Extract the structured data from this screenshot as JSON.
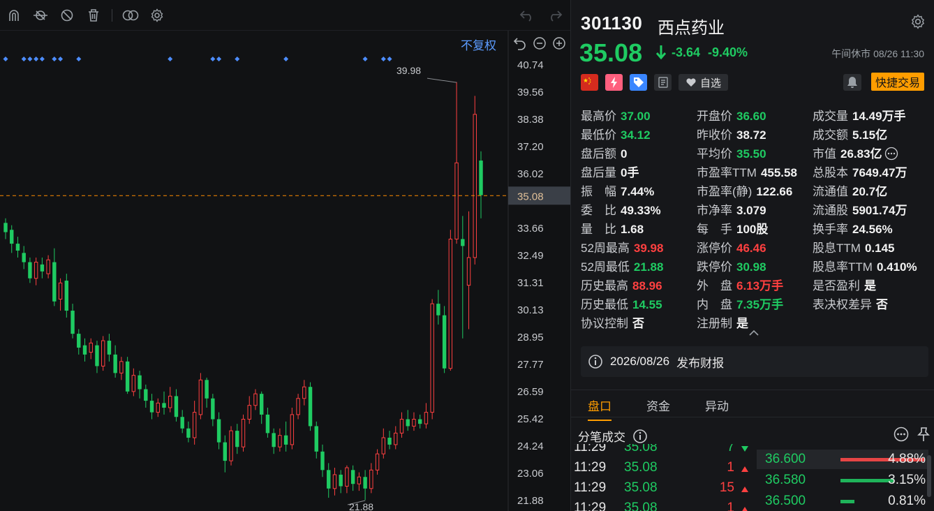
{
  "toolbar": {
    "icons": [
      "magnet-icon",
      "indicator-icon",
      "hide-icon",
      "trash-icon",
      "overlay-icon",
      "gear-icon"
    ],
    "undo_label": "undo-icon",
    "redo_label": "redo-icon"
  },
  "chart": {
    "adjust_label": "不复权",
    "price_axis": [
      "40.74",
      "39.56",
      "38.38",
      "37.20",
      "36.02",
      "35.08",
      "33.66",
      "32.49",
      "31.31",
      "30.13",
      "28.95",
      "27.77",
      "26.59",
      "25.42",
      "24.24",
      "23.06",
      "21.88"
    ],
    "current_price": "35.08",
    "high_label": "39.98",
    "low_label": "21.88",
    "colors": {
      "up": "#ff4040",
      "down": "#1fcb62",
      "marker": "#4d8dff",
      "current_line": "#ff8a00"
    }
  },
  "chart_data": {
    "type": "candlestick",
    "y_range": [
      21.88,
      40.74
    ],
    "max_marker": 39.98,
    "min_marker": 21.88,
    "current_price": 35.08,
    "candles": [
      {
        "o": 33.9,
        "c": 33.5,
        "h": 34.1,
        "l": 33.2
      },
      {
        "o": 33.6,
        "c": 33.0,
        "h": 33.8,
        "l": 32.6
      },
      {
        "o": 33.0,
        "c": 32.7,
        "h": 33.3,
        "l": 32.4
      },
      {
        "o": 32.6,
        "c": 32.2,
        "h": 32.9,
        "l": 31.9
      },
      {
        "o": 32.2,
        "c": 31.5,
        "h": 32.4,
        "l": 31.3
      },
      {
        "o": 31.5,
        "c": 32.2,
        "h": 32.4,
        "l": 31.2
      },
      {
        "o": 32.1,
        "c": 31.8,
        "h": 32.4,
        "l": 31.5
      },
      {
        "o": 31.7,
        "c": 32.3,
        "h": 32.5,
        "l": 31.5
      },
      {
        "o": 32.2,
        "c": 30.5,
        "h": 32.8,
        "l": 30.3
      },
      {
        "o": 30.6,
        "c": 31.3,
        "h": 31.5,
        "l": 30.1
      },
      {
        "o": 31.4,
        "c": 30.1,
        "h": 31.7,
        "l": 29.8
      },
      {
        "o": 30.1,
        "c": 29.1,
        "h": 30.4,
        "l": 28.9
      },
      {
        "o": 29.1,
        "c": 28.5,
        "h": 29.3,
        "l": 28.2
      },
      {
        "o": 28.6,
        "c": 28.2,
        "h": 28.9,
        "l": 27.9
      },
      {
        "o": 28.3,
        "c": 28.7,
        "h": 28.9,
        "l": 28.0
      },
      {
        "o": 28.6,
        "c": 27.7,
        "h": 28.8,
        "l": 27.4
      },
      {
        "o": 27.7,
        "c": 28.8,
        "h": 29.0,
        "l": 27.5
      },
      {
        "o": 28.8,
        "c": 28.2,
        "h": 29.1,
        "l": 27.9
      },
      {
        "o": 28.2,
        "c": 27.4,
        "h": 28.6,
        "l": 27.2
      },
      {
        "o": 27.4,
        "c": 27.9,
        "h": 28.1,
        "l": 27.1
      },
      {
        "o": 27.9,
        "c": 26.6,
        "h": 28.1,
        "l": 26.5
      },
      {
        "o": 26.6,
        "c": 27.3,
        "h": 27.6,
        "l": 26.4
      },
      {
        "o": 27.3,
        "c": 26.7,
        "h": 27.5,
        "l": 26.3
      },
      {
        "o": 26.7,
        "c": 26.2,
        "h": 26.9,
        "l": 25.9
      },
      {
        "o": 26.2,
        "c": 25.7,
        "h": 26.5,
        "l": 25.4
      },
      {
        "o": 25.7,
        "c": 26.1,
        "h": 26.3,
        "l": 25.5
      },
      {
        "o": 26.1,
        "c": 25.9,
        "h": 26.6,
        "l": 25.6
      },
      {
        "o": 25.9,
        "c": 26.4,
        "h": 26.8,
        "l": 25.7
      },
      {
        "o": 26.4,
        "c": 25.5,
        "h": 26.7,
        "l": 25.3
      },
      {
        "o": 25.5,
        "c": 25.0,
        "h": 25.8,
        "l": 24.8
      },
      {
        "o": 25.0,
        "c": 24.6,
        "h": 25.3,
        "l": 24.4
      },
      {
        "o": 24.6,
        "c": 25.7,
        "h": 26.2,
        "l": 24.3
      },
      {
        "o": 25.6,
        "c": 27.1,
        "h": 27.4,
        "l": 25.4
      },
      {
        "o": 27.1,
        "c": 26.3,
        "h": 27.2,
        "l": 25.9
      },
      {
        "o": 26.3,
        "c": 25.4,
        "h": 26.5,
        "l": 25.1
      },
      {
        "o": 25.4,
        "c": 24.4,
        "h": 25.7,
        "l": 24.1
      },
      {
        "o": 24.4,
        "c": 23.6,
        "h": 24.7,
        "l": 23.1
      },
      {
        "o": 23.6,
        "c": 24.9,
        "h": 25.1,
        "l": 23.4
      },
      {
        "o": 24.9,
        "c": 24.2,
        "h": 25.2,
        "l": 23.9
      },
      {
        "o": 24.2,
        "c": 25.4,
        "h": 25.6,
        "l": 24.0
      },
      {
        "o": 25.4,
        "c": 26.0,
        "h": 26.4,
        "l": 25.2
      },
      {
        "o": 26.0,
        "c": 26.5,
        "h": 26.7,
        "l": 25.8
      },
      {
        "o": 26.5,
        "c": 25.6,
        "h": 26.6,
        "l": 25.2
      },
      {
        "o": 25.6,
        "c": 24.8,
        "h": 25.9,
        "l": 24.6
      },
      {
        "o": 24.8,
        "c": 24.2,
        "h": 25.0,
        "l": 23.9
      },
      {
        "o": 24.2,
        "c": 24.7,
        "h": 25.0,
        "l": 24.0
      },
      {
        "o": 24.7,
        "c": 24.3,
        "h": 25.3,
        "l": 24.0
      },
      {
        "o": 24.3,
        "c": 25.6,
        "h": 25.9,
        "l": 24.1
      },
      {
        "o": 25.6,
        "c": 26.3,
        "h": 26.5,
        "l": 25.4
      },
      {
        "o": 26.3,
        "c": 26.8,
        "h": 27.1,
        "l": 26.0
      },
      {
        "o": 26.8,
        "c": 25.1,
        "h": 27.0,
        "l": 24.9
      },
      {
        "o": 25.1,
        "c": 24.0,
        "h": 25.3,
        "l": 23.7
      },
      {
        "o": 24.0,
        "c": 23.2,
        "h": 24.3,
        "l": 22.9
      },
      {
        "o": 23.2,
        "c": 22.4,
        "h": 23.5,
        "l": 22.0
      },
      {
        "o": 22.4,
        "c": 23.0,
        "h": 23.3,
        "l": 22.1
      },
      {
        "o": 23.0,
        "c": 22.5,
        "h": 23.2,
        "l": 22.2
      },
      {
        "o": 22.5,
        "c": 23.3,
        "h": 23.4,
        "l": 22.2
      },
      {
        "o": 23.2,
        "c": 22.6,
        "h": 23.4,
        "l": 22.3
      },
      {
        "o": 22.6,
        "c": 22.9,
        "h": 23.1,
        "l": 22.3
      },
      {
        "o": 22.9,
        "c": 22.4,
        "h": 23.2,
        "l": 21.9
      },
      {
        "o": 22.4,
        "c": 23.2,
        "h": 23.5,
        "l": 22.2
      },
      {
        "o": 23.2,
        "c": 23.9,
        "h": 24.1,
        "l": 23.0
      },
      {
        "o": 23.9,
        "c": 24.6,
        "h": 25.0,
        "l": 23.7
      },
      {
        "o": 24.6,
        "c": 24.3,
        "h": 24.9,
        "l": 24.1
      },
      {
        "o": 24.3,
        "c": 24.8,
        "h": 25.1,
        "l": 24.1
      },
      {
        "o": 24.8,
        "c": 25.4,
        "h": 25.7,
        "l": 24.6
      },
      {
        "o": 25.4,
        "c": 25.1,
        "h": 25.8,
        "l": 24.9
      },
      {
        "o": 25.1,
        "c": 25.4,
        "h": 25.7,
        "l": 24.9
      },
      {
        "o": 25.4,
        "c": 25.2,
        "h": 25.6,
        "l": 25.0
      },
      {
        "o": 25.2,
        "c": 25.7,
        "h": 26.1,
        "l": 25.0
      },
      {
        "o": 25.7,
        "c": 30.4,
        "h": 30.6,
        "l": 25.4
      },
      {
        "o": 30.4,
        "c": 29.9,
        "h": 31.0,
        "l": 29.5
      },
      {
        "o": 29.9,
        "c": 27.6,
        "h": 30.3,
        "l": 27.4
      },
      {
        "o": 27.6,
        "c": 33.2,
        "h": 33.6,
        "l": 27.5
      },
      {
        "o": 33.2,
        "c": 36.5,
        "h": 40.0,
        "l": 33.0
      },
      {
        "o": 33.2,
        "c": 32.9,
        "h": 34.2,
        "l": 28.9
      },
      {
        "o": 31.2,
        "c": 32.4,
        "h": 34.4,
        "l": 29.3
      },
      {
        "o": 32.4,
        "c": 38.6,
        "h": 39.4,
        "l": 32.1
      },
      {
        "o": 36.6,
        "c": 35.1,
        "h": 37.0,
        "l": 34.1
      }
    ],
    "event_markers_at": [
      0,
      3,
      4,
      5,
      6,
      8,
      9,
      12,
      27,
      34,
      35,
      38,
      46,
      59,
      62,
      63
    ]
  },
  "stock": {
    "code": "301130",
    "name": "西点药业",
    "price": "35.08",
    "change": "-3.64",
    "change_pct": "-9.40%",
    "status": "午间休市 08/26 11:30"
  },
  "badges": {
    "watch_label": "自选",
    "quick_trade_label": "快捷交易"
  },
  "stats": [
    {
      "label": "最高价",
      "value": "37.00",
      "color": "green"
    },
    {
      "label": "开盘价",
      "value": "36.60",
      "color": "green"
    },
    {
      "label": "成交量",
      "value": "14.49万手",
      "color": "white"
    },
    {
      "label": "最低价",
      "value": "34.12",
      "color": "green"
    },
    {
      "label": "昨收价",
      "value": "38.72",
      "color": "white"
    },
    {
      "label": "成交额",
      "value": "5.15亿",
      "color": "white"
    },
    {
      "label": "盘后额",
      "value": "0",
      "color": "white"
    },
    {
      "label": "平均价",
      "value": "35.50",
      "color": "green"
    },
    {
      "label": "市值",
      "value": "26.83亿",
      "color": "white"
    },
    {
      "label": "盘后量",
      "value": "0手",
      "color": "white"
    },
    {
      "label": "市盈率TTM",
      "value": "455.58",
      "color": "white"
    },
    {
      "label": "总股本",
      "value": "7649.47万",
      "color": "white"
    },
    {
      "label": "振　幅",
      "value": "7.44%",
      "color": "white"
    },
    {
      "label": "市盈率(静)",
      "value": "122.66",
      "color": "white"
    },
    {
      "label": "流通值",
      "value": "20.7亿",
      "color": "white"
    },
    {
      "label": "委　比",
      "value": "49.33%",
      "color": "white"
    },
    {
      "label": "市净率",
      "value": "3.079",
      "color": "white"
    },
    {
      "label": "流通股",
      "value": "5901.74万",
      "color": "white"
    },
    {
      "label": "量　比",
      "value": "1.68",
      "color": "white"
    },
    {
      "label": "每　手",
      "value": "100股",
      "color": "white"
    },
    {
      "label": "换手率",
      "value": "24.56%",
      "color": "white"
    },
    {
      "label": "52周最高",
      "value": "39.98",
      "color": "red"
    },
    {
      "label": "涨停价",
      "value": "46.46",
      "color": "red"
    },
    {
      "label": "股息TTM",
      "value": "0.145",
      "color": "white"
    },
    {
      "label": "52周最低",
      "value": "21.88",
      "color": "green"
    },
    {
      "label": "跌停价",
      "value": "30.98",
      "color": "green"
    },
    {
      "label": "股息率TTM",
      "value": "0.410%",
      "color": "white"
    },
    {
      "label": "历史最高",
      "value": "88.96",
      "color": "red"
    },
    {
      "label": "外　盘",
      "value": "6.13万手",
      "color": "red"
    },
    {
      "label": "是否盈利",
      "value": "是",
      "color": "white"
    },
    {
      "label": "历史最低",
      "value": "14.55",
      "color": "green"
    },
    {
      "label": "内　盘",
      "value": "7.35万手",
      "color": "green"
    },
    {
      "label": "表决权差异",
      "value": "否",
      "color": "white"
    },
    {
      "label": "协议控制",
      "value": "否",
      "color": "white"
    },
    {
      "label": "注册制",
      "value": "是",
      "color": "white"
    }
  ],
  "notice": {
    "date": "2026/08/26",
    "text": "发布财报"
  },
  "tabs": [
    {
      "label": "盘口",
      "active": true
    },
    {
      "label": "资金",
      "active": false
    },
    {
      "label": "异动",
      "active": false
    }
  ],
  "tick_header": "分笔成交",
  "ticks": [
    {
      "time": "11:29",
      "price": "35.08",
      "vol": "7",
      "dir": "down"
    },
    {
      "time": "11:29",
      "price": "35.08",
      "vol": "1",
      "dir": "up"
    },
    {
      "time": "11:29",
      "price": "35.08",
      "vol": "15",
      "dir": "up"
    },
    {
      "time": "11:29",
      "price": "35.08",
      "vol": "1",
      "dir": "up"
    }
  ],
  "depth": [
    {
      "price": "36.600",
      "pct": "4.88%",
      "share": 0.0488,
      "color": "#e64545"
    },
    {
      "price": "36.580",
      "pct": "3.15%",
      "share": 0.0315,
      "color": "#1fb35a"
    },
    {
      "price": "36.500",
      "pct": "0.81%",
      "share": 0.0081,
      "color": "#1fb35a"
    }
  ]
}
